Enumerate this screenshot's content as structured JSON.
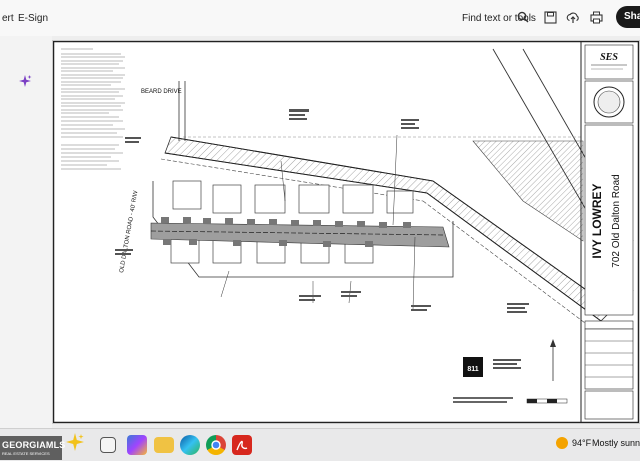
{
  "toolbar": {
    "left_partial": "ert",
    "esign": "E-Sign",
    "find_text": "Find text or tools",
    "share": "Share"
  },
  "plan": {
    "logo": "SES",
    "title_block": {
      "name": "IVY LOWREY",
      "address": "702 Old Dalton Road"
    },
    "labels": {
      "beard_drive": "BEARD DRIVE",
      "old_dalton": "OLD DALTON ROAD - 40' R/W",
      "badge": "811"
    }
  },
  "taskbar": {
    "weather_temp": "94°F",
    "weather_desc": "Mostly sunny"
  },
  "watermark": {
    "brand": "GEORGIAMLS",
    "tagline": "REAL ESTATE SERVICES"
  },
  "colors": {
    "accent": "#7b3fc4",
    "share_bg": "#1a1a1a",
    "acrobat_red": "#d7281e"
  }
}
